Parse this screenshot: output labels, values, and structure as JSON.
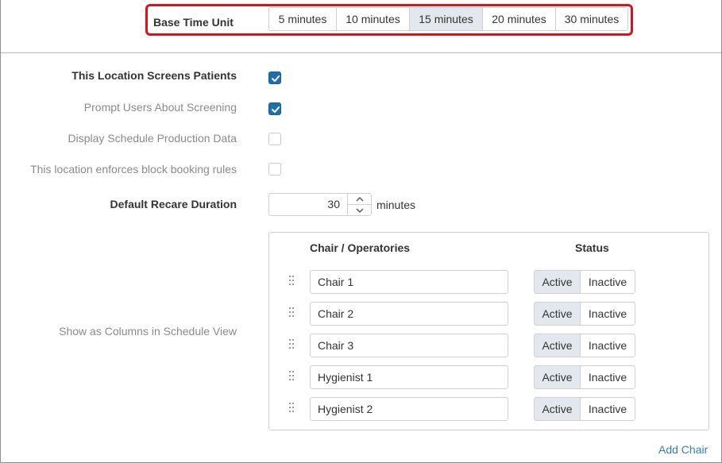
{
  "base_time_unit": {
    "label": "Base Time Unit",
    "options": [
      "5 minutes",
      "10 minutes",
      "15 minutes",
      "20 minutes",
      "30 minutes"
    ],
    "selected": "15 minutes"
  },
  "settings": {
    "screens_patients": {
      "label": "This Location Screens Patients",
      "checked": true
    },
    "prompt_screening": {
      "label": "Prompt Users About Screening",
      "checked": true
    },
    "display_production": {
      "label": "Display Schedule Production Data",
      "checked": false
    },
    "block_booking": {
      "label": "This location enforces block booking rules",
      "checked": false
    }
  },
  "recare": {
    "label": "Default Recare Duration",
    "value": "30",
    "unit": "minutes"
  },
  "columns": {
    "label": "Show as Columns in Schedule View",
    "header_chair": "Chair / Operatories",
    "header_status": "Status",
    "active_label": "Active",
    "inactive_label": "Inactive",
    "chairs": [
      {
        "name": "Chair 1",
        "status": "Active"
      },
      {
        "name": "Chair 2",
        "status": "Active"
      },
      {
        "name": "Chair 3",
        "status": "Active"
      },
      {
        "name": "Hygienist 1",
        "status": "Active"
      },
      {
        "name": "Hygienist 2",
        "status": "Active"
      }
    ]
  },
  "add_chair_label": "Add Chair",
  "colors": {
    "accent": "#1f6fa8",
    "highlight": "#d9121b",
    "link": "#2f7fb5",
    "selected_bg": "#e3e8ee"
  }
}
